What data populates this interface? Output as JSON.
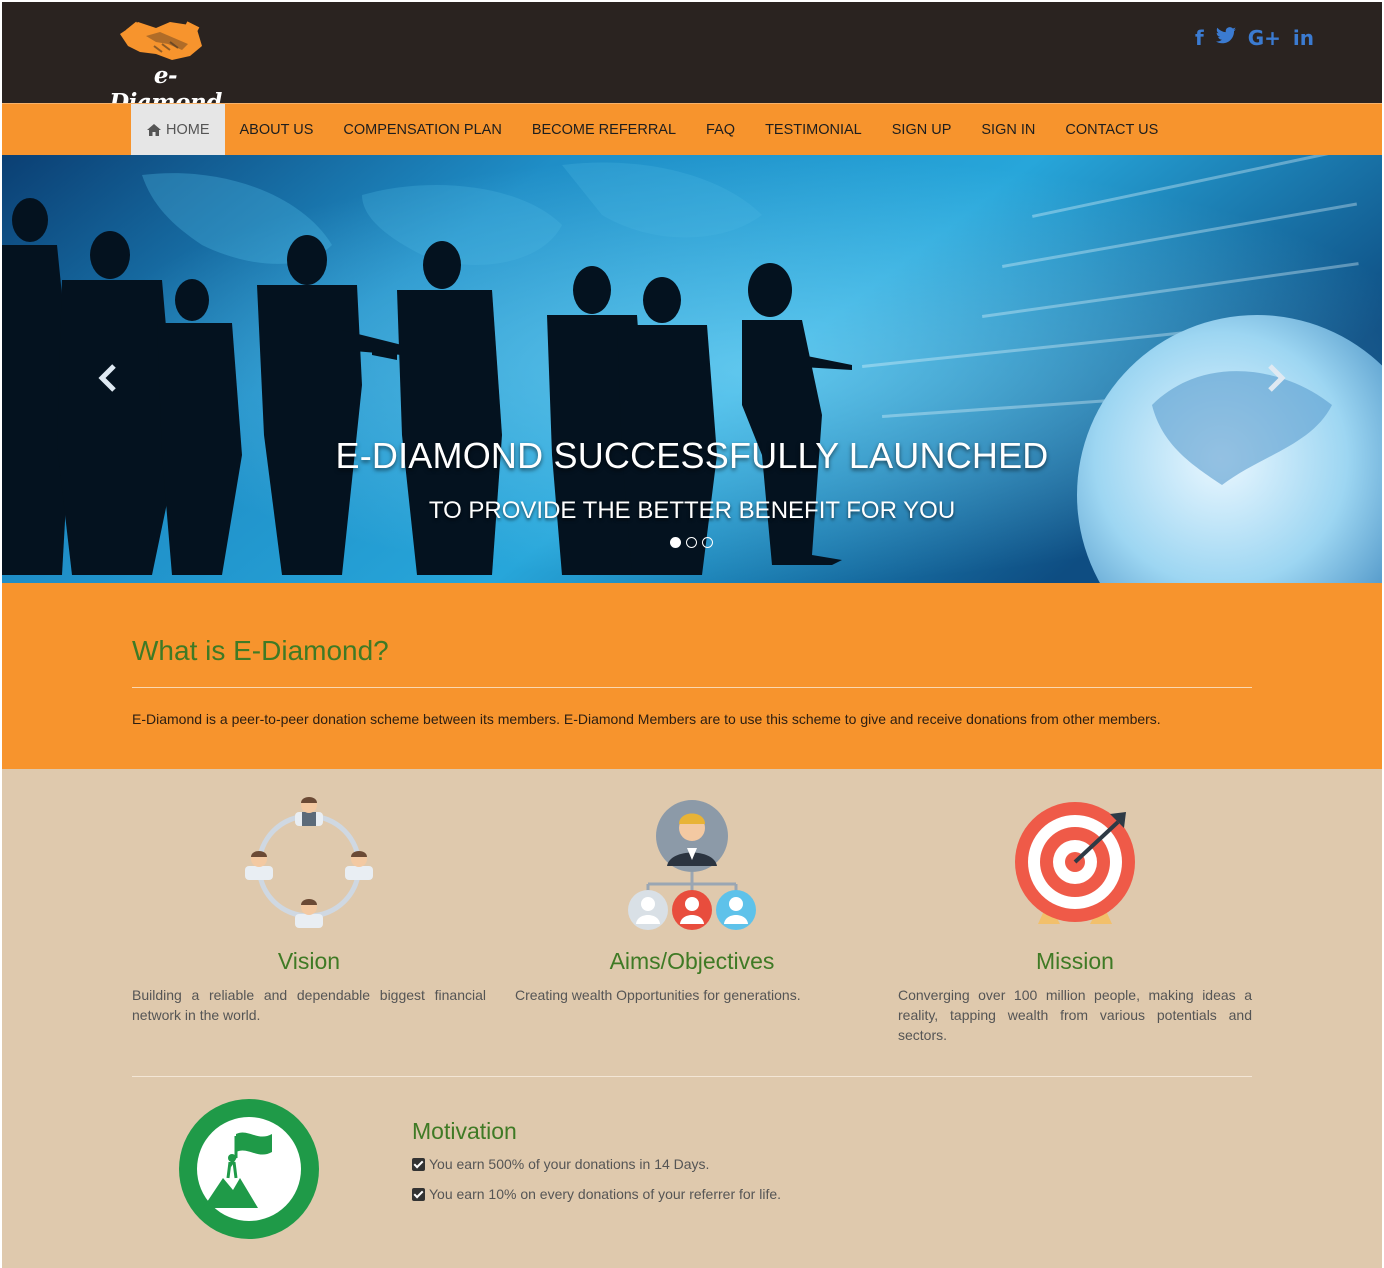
{
  "header": {
    "logo_text": "e-Diamond",
    "social": [
      {
        "icon": "facebook-icon",
        "label": "f"
      },
      {
        "icon": "twitter-icon",
        "label": "t"
      },
      {
        "icon": "google-plus-icon",
        "label": "G+"
      },
      {
        "icon": "linkedin-icon",
        "label": "in"
      }
    ]
  },
  "nav": {
    "items": [
      "HOME",
      "ABOUT US",
      "COMPENSATION PLAN",
      "BECOME REFERRAL",
      "FAQ",
      "TESTIMONIAL",
      "SIGN UP",
      "SIGN IN",
      "CONTACT US"
    ],
    "active": "HOME"
  },
  "hero": {
    "title": "E-DIAMOND SUCCESSFULLY LAUNCHED",
    "subtitle": "TO PROVIDE THE BETTER BENEFIT FOR YOU",
    "slides": 3,
    "active_slide": 1
  },
  "about": {
    "heading": "What is E-Diamond?",
    "text": "E-Diamond is a peer-to-peer donation scheme between its members. E-Diamond Members are to use this scheme to give and receive donations from other members."
  },
  "features": [
    {
      "icon": "network-people-icon",
      "title": "Vision",
      "text": "Building a reliable and dependable biggest financial network in the world."
    },
    {
      "icon": "team-hierarchy-icon",
      "title": "Aims/Objectives",
      "text": "Creating wealth Opportunities for generations."
    },
    {
      "icon": "target-icon",
      "title": "Mission",
      "text": "Converging over 100 million people, making ideas a reality, tapping wealth from various potentials and sectors."
    }
  ],
  "motivation": {
    "icon": "mountain-flag-icon",
    "title": "Motivation",
    "items": [
      "You earn 500% of your donations in 14 Days.",
      "You earn 10% on every donations of your referrer for life."
    ]
  },
  "colors": {
    "header_bg": "#2a2320",
    "accent_orange": "#f7942d",
    "content_bg": "#dfc9ad",
    "heading_green": "#3f7a25",
    "social_blue": "#3b7bd1"
  }
}
